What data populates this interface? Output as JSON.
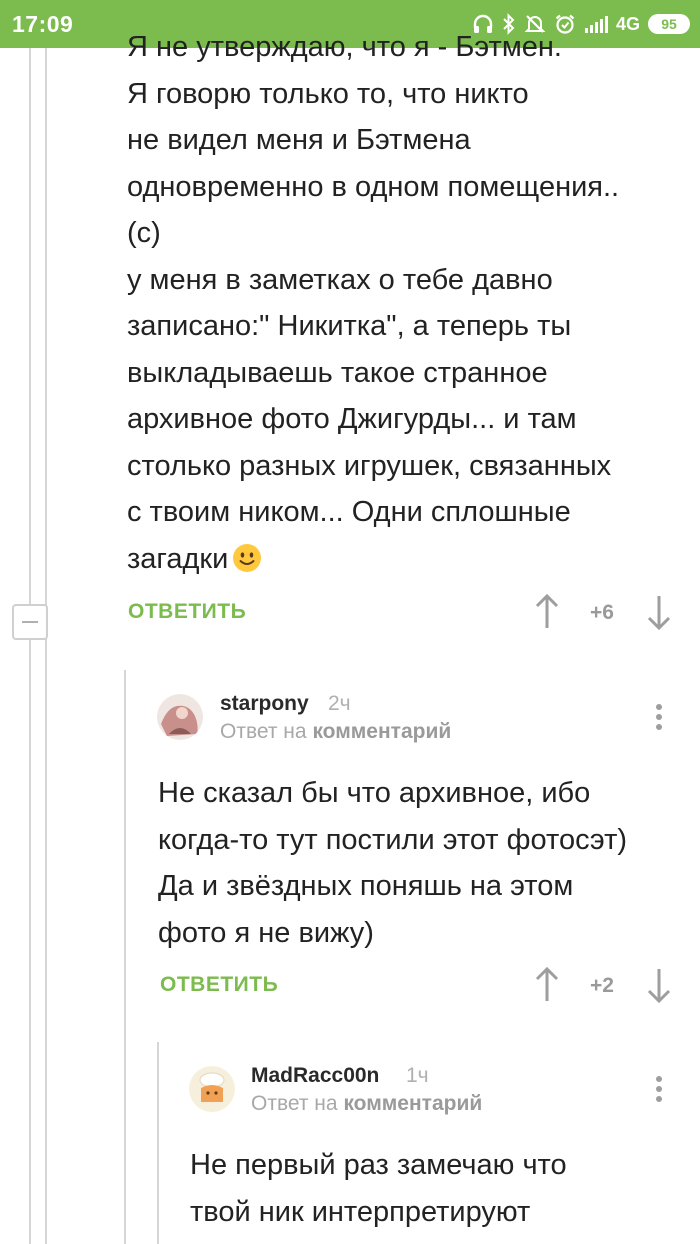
{
  "status_bar": {
    "time": "17:09",
    "network": "4G",
    "battery": "95",
    "icons": [
      "headphones-icon",
      "bluetooth-icon",
      "mute-bell-icon",
      "alarm-icon",
      "signal-icon"
    ]
  },
  "colors": {
    "accent": "#7cbb4d",
    "muted": "#9a9a9a",
    "text": "#222222",
    "thread_line": "#d6d6d6"
  },
  "comments": [
    {
      "text_lines": [
        "Я не утверждаю, что я - Бэтмен.",
        "Я говорю только то, что никто",
        "не видел меня и Бэтмена",
        "одновременно в одном помещения..",
        "(с)",
        "у меня в заметках о тебе давно",
        "записано:\" Никитка\", а теперь ты",
        "выкладываешь такое странное",
        "архивное фото Джигурды... и там",
        "столько разных игрушек, связанных",
        "с твоим ником... Одни сплошные",
        "загадки"
      ],
      "emoji": "smiling-face-emoji",
      "reply_label": "ОТВЕТИТЬ",
      "score": "+6"
    },
    {
      "username": "starpony",
      "time_ago": "2ч",
      "reply_to_prefix": "Ответ на",
      "reply_to_link": "комментарий",
      "text_lines": [
        "Не сказал бы что архивное, ибо",
        "когда-то тут постили этот фотосэт)",
        "Да и звёздных поняшь на этом",
        "фото я не вижу)"
      ],
      "reply_label": "ОТВЕТИТЬ",
      "score": "+2"
    },
    {
      "username": "MadRacc00n",
      "time_ago": "1ч",
      "reply_to_prefix": "Ответ на",
      "reply_to_link": "комментарий",
      "text_lines": [
        "Не первый раз замечаю что",
        "твой ник интерпретируют"
      ]
    }
  ]
}
